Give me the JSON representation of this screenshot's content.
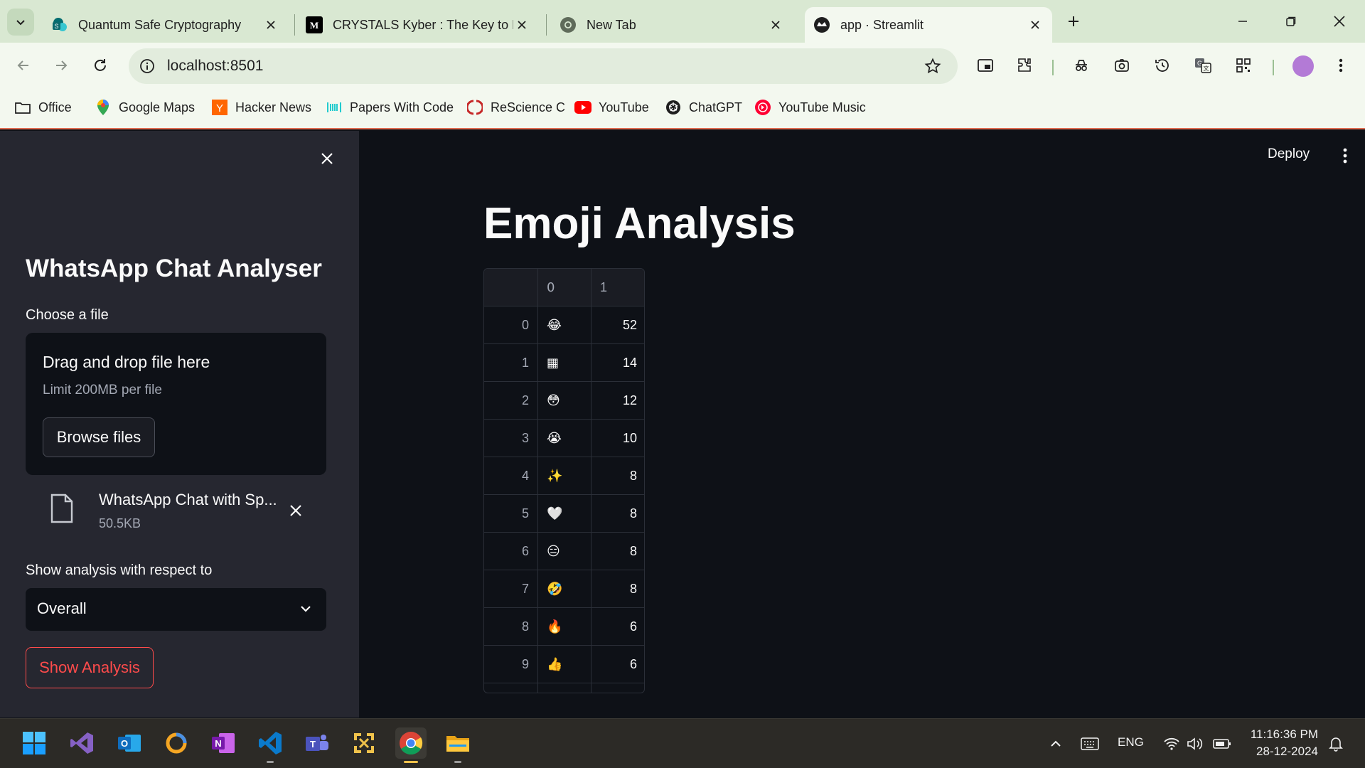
{
  "browser": {
    "tabs": [
      {
        "title": "Quantum Safe Cryptography",
        "icon": "sharepoint-icon",
        "active": false
      },
      {
        "title": "CRYSTALS Kyber : The Key to Po",
        "icon": "medium-icon",
        "active": false
      },
      {
        "title": "New Tab",
        "icon": "chrome-icon",
        "active": false
      },
      {
        "title": "app · Streamlit",
        "icon": "streamlit-icon",
        "active": true
      }
    ],
    "url": "localhost:8501",
    "bookmarks": [
      {
        "label": "Office",
        "icon": "folder-icon"
      },
      {
        "label": "Google Maps",
        "icon": "maps-pin-icon"
      },
      {
        "label": "Hacker News",
        "icon": "y-combinator-icon",
        "badge": "Y"
      },
      {
        "label": "Papers With Code",
        "icon": "papers-icon"
      },
      {
        "label": "ReScience C",
        "icon": "rescience-icon"
      },
      {
        "label": "YouTube",
        "icon": "youtube-icon"
      },
      {
        "label": "ChatGPT",
        "icon": "chatgpt-icon"
      },
      {
        "label": "YouTube Music",
        "icon": "youtube-music-icon"
      }
    ],
    "colors": {
      "chrome_bg": "#d9e8d2",
      "toolbar_bg": "#f3f8ef"
    }
  },
  "sidebar": {
    "title": "WhatsApp Chat Analyser",
    "file_label": "Choose a file",
    "dropzone_title": "Drag and drop file here",
    "dropzone_limit": "Limit 200MB per file",
    "browse_label": "Browse files",
    "uploaded_file_name": "WhatsApp Chat with Sp...",
    "uploaded_file_size": "50.5KB",
    "select_label": "Show analysis with respect to",
    "select_value": "Overall",
    "show_button": "Show Analysis"
  },
  "main": {
    "deploy_label": "Deploy",
    "title": "Emoji Analysis",
    "table": {
      "columns": [
        "",
        "0",
        "1"
      ],
      "rows": [
        {
          "index": "0",
          "emoji": "😂",
          "count": "52"
        },
        {
          "index": "1",
          "emoji": "▦",
          "count": "14"
        },
        {
          "index": "2",
          "emoji": "😳",
          "count": "12"
        },
        {
          "index": "3",
          "emoji": "😭",
          "count": "10"
        },
        {
          "index": "4",
          "emoji": "✨",
          "count": "8"
        },
        {
          "index": "5",
          "emoji": "🤍",
          "count": "8"
        },
        {
          "index": "6",
          "emoji": "😑",
          "count": "8"
        },
        {
          "index": "7",
          "emoji": "🤣",
          "count": "8"
        },
        {
          "index": "8",
          "emoji": "🔥",
          "count": "6"
        },
        {
          "index": "9",
          "emoji": "👍",
          "count": "6"
        }
      ]
    },
    "colors": {
      "accent": "#ff4b4b",
      "bg": "#0e1117",
      "sidebar_bg": "#262730"
    }
  },
  "taskbar": {
    "apps": [
      "windows-start-icon",
      "visual-studio-icon",
      "outlook-icon",
      "blender-like-icon",
      "onenote-icon",
      "vscode-icon",
      "teams-icon",
      "network-tool-icon",
      "chrome-icon",
      "file-explorer-icon"
    ],
    "language": "ENG",
    "time": "11:16:36 PM",
    "date": "28-12-2024"
  }
}
